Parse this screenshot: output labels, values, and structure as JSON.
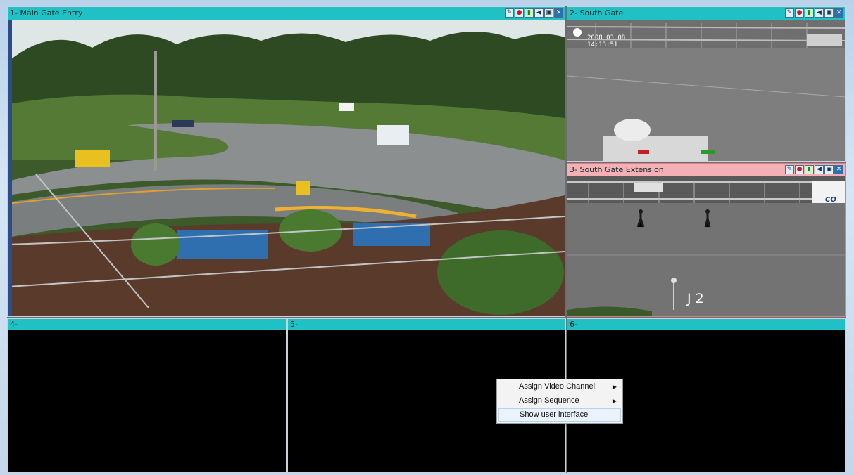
{
  "panes": [
    {
      "id": "1",
      "title": "1- Main Gate Entry",
      "has_video": true
    },
    {
      "id": "2",
      "title": "2- South Gate",
      "has_video": true,
      "overlay": {
        "date": "2008 03 08",
        "time": "14:13:51"
      }
    },
    {
      "id": "3",
      "title": "3- South Gate Extension",
      "has_video": true,
      "overlay": {
        "label": "J 2",
        "sign_text": "CO"
      },
      "alert": true
    },
    {
      "id": "4",
      "title": "4-",
      "has_video": false
    },
    {
      "id": "5",
      "title": "5-",
      "has_video": false
    },
    {
      "id": "6",
      "title": "6-",
      "has_video": false
    }
  ],
  "toolbar_icons": [
    "info-icon",
    "record-icon",
    "ptz-icon",
    "audio-icon",
    "snapshot-icon",
    "close-icon"
  ],
  "toolbar_glyphs": [
    "✎",
    "●",
    "▮",
    "◀",
    "▣",
    "✕"
  ],
  "context_menu": {
    "items": [
      {
        "label": "Assign Video Channel",
        "has_submenu": true
      },
      {
        "label": "Assign Sequence",
        "has_submenu": true
      },
      {
        "label": "Show user interface",
        "has_submenu": false
      }
    ]
  },
  "colors": {
    "titlebar": "#1fc1c4",
    "alert_titlebar": "#f4b0b5"
  }
}
